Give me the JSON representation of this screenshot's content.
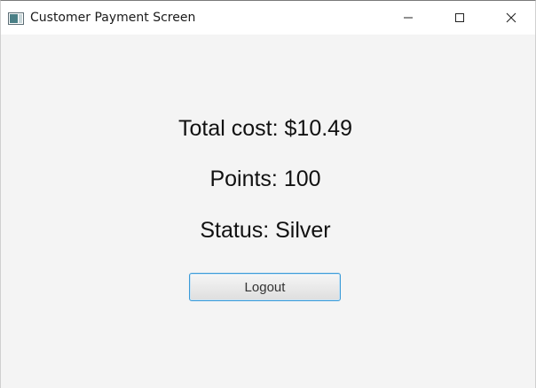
{
  "window": {
    "title": "Customer Payment Screen",
    "icons": {
      "app": "app-window-icon",
      "minimize": "minimize-icon",
      "maximize": "maximize-icon",
      "close": "close-icon"
    }
  },
  "summary": {
    "total_cost": "Total cost: $10.49",
    "points": "Points: 100",
    "status": "Status: Silver"
  },
  "actions": {
    "logout_label": "Logout"
  },
  "colors": {
    "background": "#f4f4f4",
    "button_focus_border": "#3b9bd8"
  }
}
